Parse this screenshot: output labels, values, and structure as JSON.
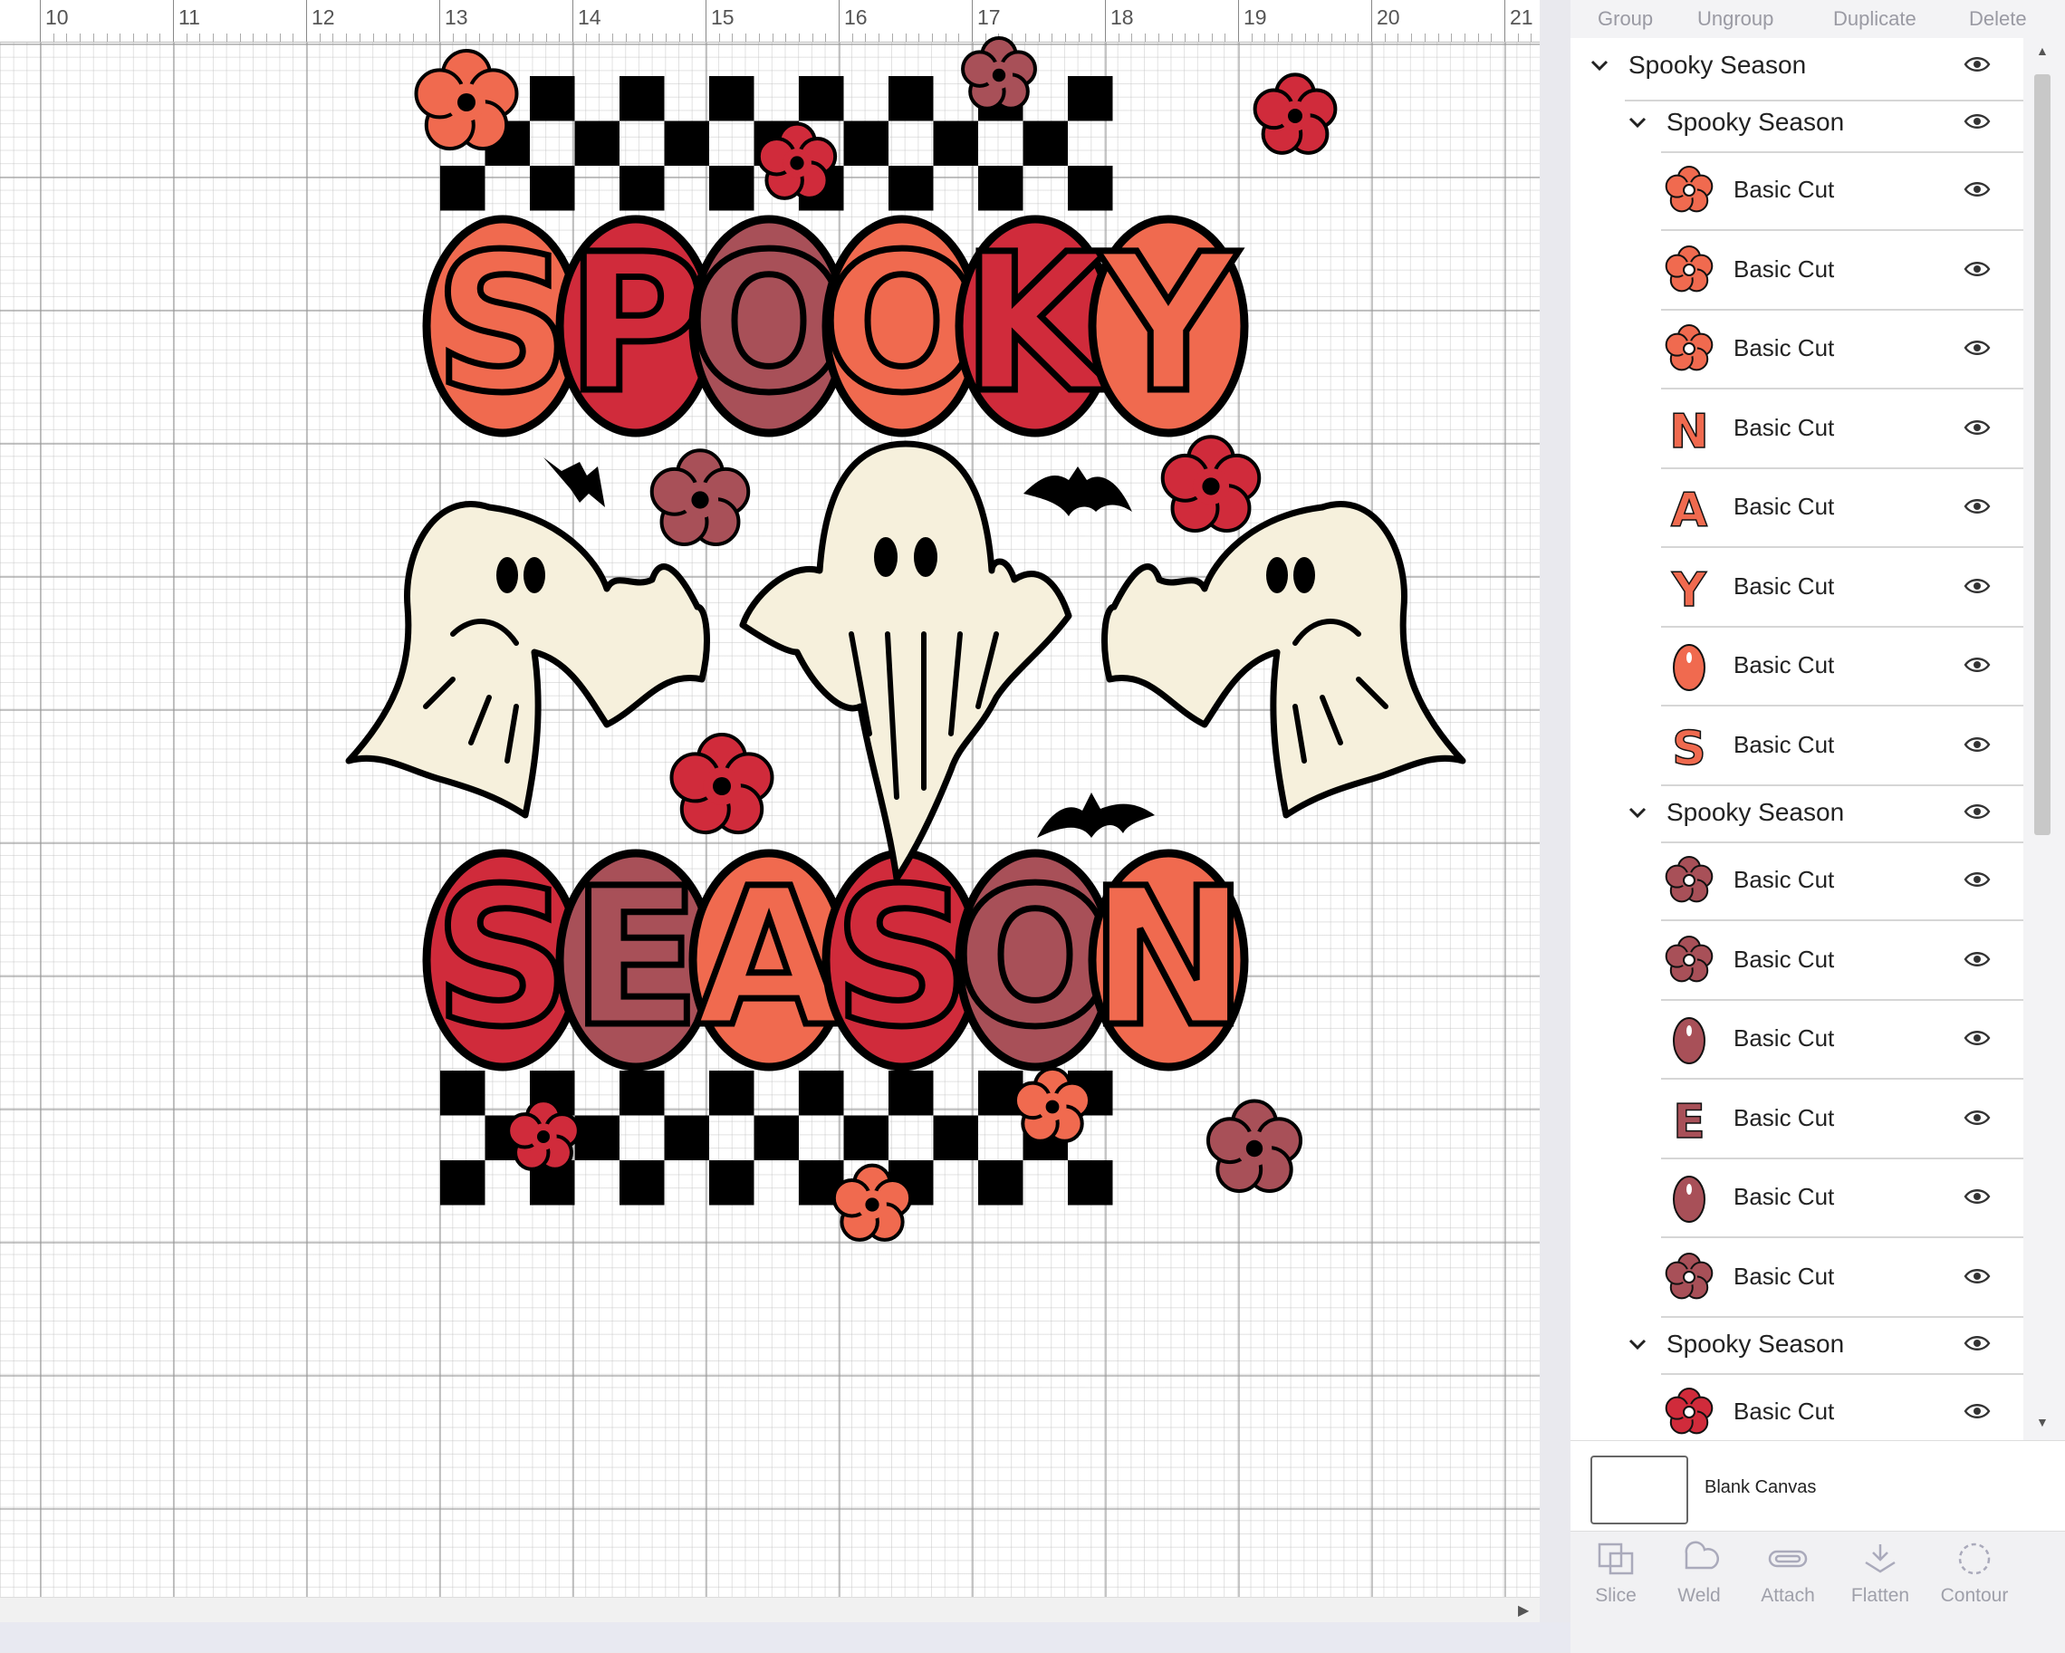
{
  "ruler": {
    "numbers": [
      "10",
      "11",
      "12",
      "13",
      "14",
      "15",
      "16",
      "17",
      "18",
      "19",
      "20",
      "21"
    ]
  },
  "toolbar": {
    "group": "Group",
    "ungroup": "Ungroup",
    "duplicate": "Duplicate",
    "delete": "Delete"
  },
  "layers": {
    "root": {
      "title": "Spooky Season"
    },
    "groups": [
      {
        "title": "Spooky Season",
        "items": [
          {
            "label": "Basic Cut",
            "icon": "flower-icon",
            "color": "#F06A4F"
          },
          {
            "label": "Basic Cut",
            "icon": "flower-icon",
            "color": "#F06A4F"
          },
          {
            "label": "Basic Cut",
            "icon": "flower-icon",
            "color": "#F06A4F"
          },
          {
            "label": "Basic Cut",
            "icon": "letter-n-icon",
            "color": "#F06A4F"
          },
          {
            "label": "Basic Cut",
            "icon": "letter-a-icon",
            "color": "#F06A4F"
          },
          {
            "label": "Basic Cut",
            "icon": "letter-y-icon",
            "color": "#F06A4F"
          },
          {
            "label": "Basic Cut",
            "icon": "letter-o-icon",
            "color": "#F06A4F"
          },
          {
            "label": "Basic Cut",
            "icon": "letter-s-icon",
            "color": "#F06A4F"
          }
        ]
      },
      {
        "title": "Spooky Season",
        "items": [
          {
            "label": "Basic Cut",
            "icon": "flower-icon",
            "color": "#A85058"
          },
          {
            "label": "Basic Cut",
            "icon": "flower-icon",
            "color": "#A85058"
          },
          {
            "label": "Basic Cut",
            "icon": "letter-o-icon",
            "color": "#A85058"
          },
          {
            "label": "Basic Cut",
            "icon": "letter-e-icon",
            "color": "#A85058"
          },
          {
            "label": "Basic Cut",
            "icon": "letter-o-icon",
            "color": "#A85058"
          },
          {
            "label": "Basic Cut",
            "icon": "flower-icon",
            "color": "#A85058"
          }
        ]
      },
      {
        "title": "Spooky Season",
        "items": [
          {
            "label": "Basic Cut",
            "icon": "flower-icon",
            "color": "#D02B3B"
          }
        ]
      }
    ]
  },
  "canvas_label": {
    "label": "Blank Canvas"
  },
  "ops": [
    {
      "label": "Slice",
      "icon": "slice-icon"
    },
    {
      "label": "Weld",
      "icon": "weld-icon"
    },
    {
      "label": "Attach",
      "icon": "attach-icon"
    },
    {
      "label": "Flatten",
      "icon": "flatten-icon"
    },
    {
      "label": "Contour",
      "icon": "contour-icon"
    }
  ],
  "design": {
    "top_word": "SPOOKY",
    "bottom_word": "SEASON",
    "colors": {
      "orange": "#F06A4F",
      "red": "#D02B3B",
      "mauve": "#A85058",
      "cream": "#F6F0DC",
      "black": "#000000"
    },
    "top_colors": [
      "orange",
      "red",
      "mauve",
      "orange",
      "red",
      "orange"
    ],
    "bottom_colors": [
      "red",
      "mauve",
      "orange",
      "red",
      "mauve",
      "orange"
    ]
  }
}
